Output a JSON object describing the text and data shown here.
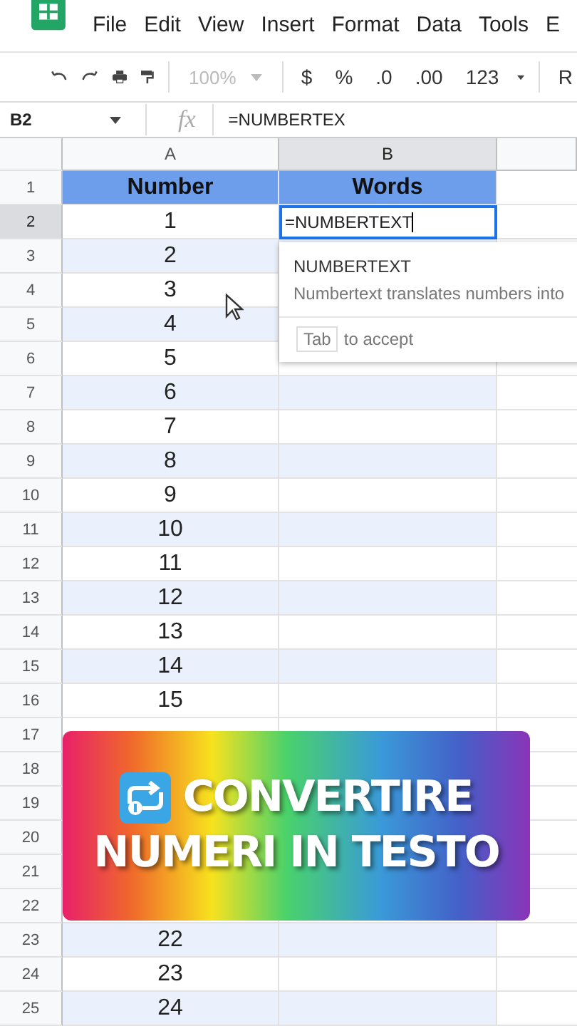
{
  "menu": [
    "File",
    "Edit",
    "View",
    "Insert",
    "Format",
    "Data",
    "Tools",
    "E"
  ],
  "toolbar": {
    "zoom": "100%",
    "currency": "$",
    "percent": "%",
    "decrease_decimal": ".0",
    "increase_decimal": ".00",
    "number_format": "123",
    "item_cut": "R"
  },
  "formula_bar": {
    "name_box": "B2",
    "fx": "fx",
    "formula": "=NUMBERTEX"
  },
  "columns": [
    {
      "letter": "A",
      "selected": false
    },
    {
      "letter": "B",
      "selected": true
    }
  ],
  "rows": [
    {
      "label": "1",
      "selected": false,
      "kind": "header",
      "cells": [
        {
          "text": "Number",
          "selected": false
        },
        {
          "text": "Words",
          "selected": false
        }
      ]
    },
    {
      "label": "2",
      "selected": true,
      "kind": "data",
      "cells": [
        {
          "text": "1",
          "selected": false
        },
        {
          "text": "=NUMBERTEXT",
          "selected": true
        }
      ]
    },
    {
      "label": "3",
      "selected": false,
      "kind": "data",
      "cells": [
        {
          "text": "2",
          "selected": false
        }
      ]
    },
    {
      "label": "4",
      "selected": false,
      "kind": "data",
      "cells": [
        {
          "text": "3",
          "selected": false
        }
      ]
    },
    {
      "label": "5",
      "selected": false,
      "kind": "data",
      "cells": [
        {
          "text": "4",
          "selected": false
        }
      ]
    },
    {
      "label": "6",
      "selected": false,
      "kind": "data",
      "cells": [
        {
          "text": "5",
          "selected": false
        }
      ]
    },
    {
      "label": "7",
      "selected": false,
      "kind": "data",
      "cells": [
        {
          "text": "6",
          "selected": false
        }
      ]
    },
    {
      "label": "8",
      "selected": false,
      "kind": "data",
      "cells": [
        {
          "text": "7",
          "selected": false
        }
      ]
    },
    {
      "label": "9",
      "selected": false,
      "kind": "data",
      "cells": [
        {
          "text": "8",
          "selected": false
        }
      ]
    },
    {
      "label": "10",
      "selected": false,
      "kind": "data",
      "cells": [
        {
          "text": "9",
          "selected": false
        }
      ]
    },
    {
      "label": "11",
      "selected": false,
      "kind": "data",
      "cells": [
        {
          "text": "10",
          "selected": false
        }
      ]
    },
    {
      "label": "12",
      "selected": false,
      "kind": "data",
      "cells": [
        {
          "text": "11",
          "selected": false
        }
      ]
    },
    {
      "label": "13",
      "selected": false,
      "kind": "data",
      "cells": [
        {
          "text": "12",
          "selected": false
        }
      ]
    },
    {
      "label": "14",
      "selected": false,
      "kind": "data",
      "cells": [
        {
          "text": "13",
          "selected": false
        }
      ]
    },
    {
      "label": "15",
      "selected": false,
      "kind": "data",
      "cells": [
        {
          "text": "14",
          "selected": false
        }
      ]
    },
    {
      "label": "16",
      "selected": false,
      "kind": "data",
      "cells": [
        {
          "text": "15",
          "selected": false
        }
      ]
    },
    {
      "label": "17",
      "selected": false,
      "kind": "data",
      "cells": []
    },
    {
      "label": "18",
      "selected": false,
      "kind": "data",
      "cells": []
    },
    {
      "label": "19",
      "selected": false,
      "kind": "data",
      "cells": []
    },
    {
      "label": "20",
      "selected": false,
      "kind": "data",
      "cells": []
    },
    {
      "label": "21",
      "selected": false,
      "kind": "data",
      "cells": []
    },
    {
      "label": "22",
      "selected": false,
      "kind": "data",
      "cells": []
    },
    {
      "label": "23",
      "selected": false,
      "kind": "data",
      "cells": [
        {
          "text": "22",
          "selected": false
        }
      ]
    },
    {
      "label": "24",
      "selected": false,
      "kind": "data",
      "cells": [
        {
          "text": "23",
          "selected": false
        }
      ]
    },
    {
      "label": "25",
      "selected": false,
      "kind": "data",
      "cells": [
        {
          "text": "24",
          "selected": false
        }
      ]
    }
  ],
  "autocomplete": {
    "function": "NUMBERTEXT",
    "description": "Numbertext translates numbers into",
    "key": "Tab",
    "hint": "to accept"
  },
  "banner": {
    "lines": [
      "CONVERTIRE",
      "NUMERI IN TESTO"
    ]
  }
}
